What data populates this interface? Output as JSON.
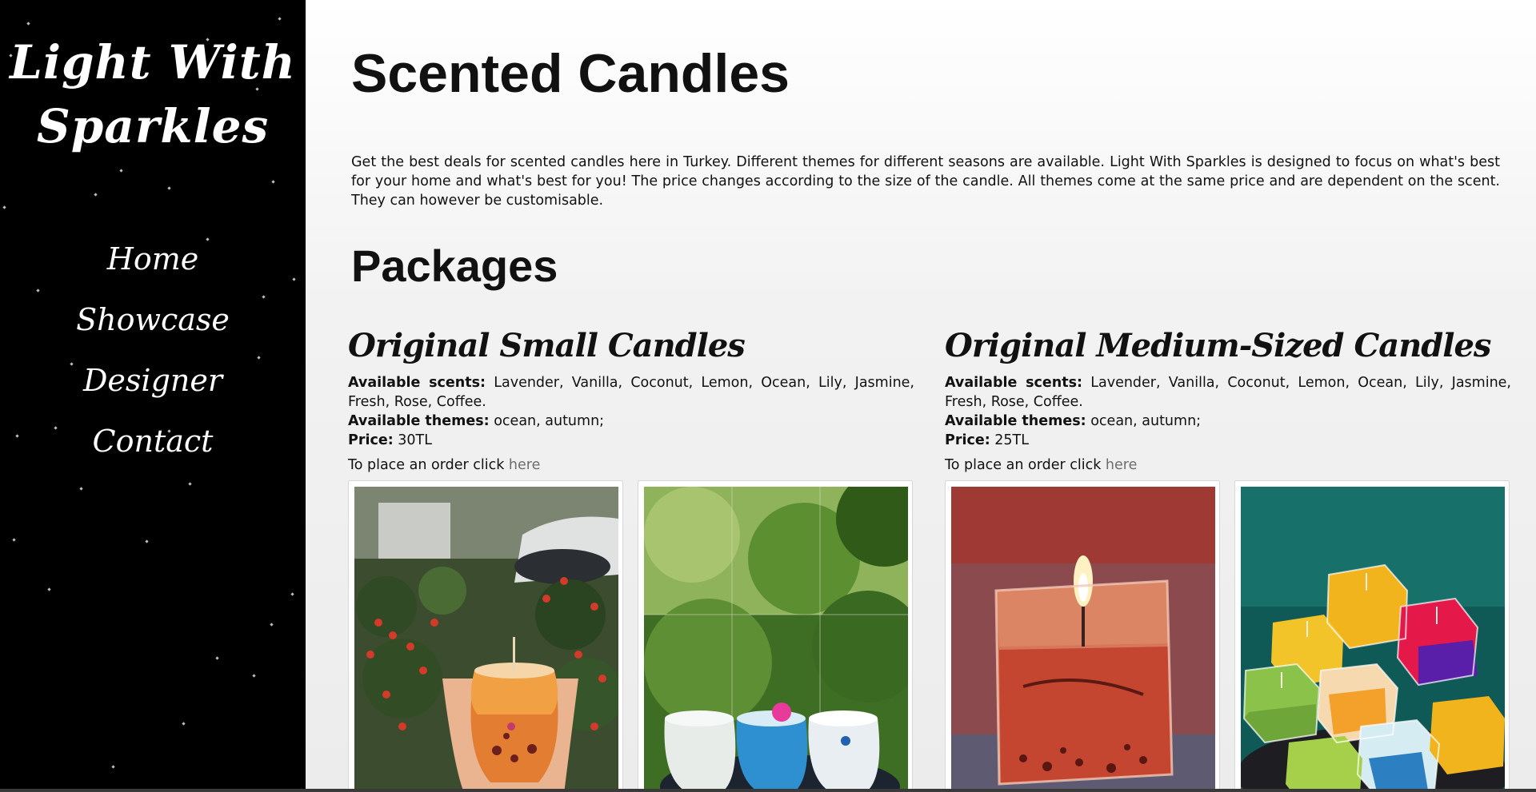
{
  "brand": {
    "line1": "Light With",
    "line2": "Sparkles"
  },
  "nav": {
    "items": [
      {
        "label": "Home"
      },
      {
        "label": "Showcase"
      },
      {
        "label": "Designer"
      },
      {
        "label": "Contact"
      }
    ]
  },
  "main": {
    "title": "Scented Candles",
    "intro": "Get the best deals for scented candles here in Turkey. Different themes for different seasons are available. Light With Sparkles is designed to focus on what's best for your home and what's best for you! The price changes according to the size of the candle. All themes come at the same price and are dependent on the scent. They can however be customisable.",
    "packages_title": "Packages",
    "packages": [
      {
        "name": "Original Small Candles",
        "scents_label": "Available scents:",
        "scents": "Lavender, Vanilla, Coconut, Lemon, Ocean, Lily, Jasmine, Fresh, Rose, Coffee.",
        "themes_label": "Available themes:",
        "themes": "ocean, autumn;",
        "price_label": "Price:",
        "price": "30TL",
        "order_text": "To place an order click",
        "order_link": "here"
      },
      {
        "name": "Original Medium-Sized Candles",
        "scents_label": "Available scents:",
        "scents": "Lavender, Vanilla, Coconut, Lemon, Ocean, Lily, Jasmine, Fresh, Rose, Coffee.",
        "themes_label": "Available themes:",
        "themes": "ocean, autumn;",
        "price_label": "Price:",
        "price": "25TL",
        "order_text": "To place an order click",
        "order_link": "here"
      }
    ]
  },
  "colors": {
    "sidebar_bg": "#000000",
    "text": "#111111",
    "link": "#6d6d6d"
  }
}
